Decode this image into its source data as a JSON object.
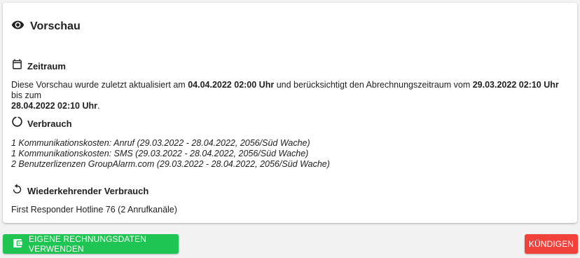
{
  "preview": {
    "title": "Vorschau",
    "icon": "eye-icon"
  },
  "period": {
    "title": "Zeitraum",
    "icon": "calendar-icon",
    "text_prefix": "Diese Vorschau wurde zuletzt aktualisiert am ",
    "updated_at": "04.04.2022 02:00 Uhr",
    "text_middle": " und berücksichtigt den Abrechnungszeitraum vom ",
    "period_start": "29.03.2022 02:10 Uhr",
    "text_until": " bis zum",
    "period_end": "28.04.2022 02:10 Uhr",
    "text_end": "."
  },
  "usage": {
    "title": "Verbrauch",
    "icon": "progress-circle-icon",
    "items": [
      "1 Kommunikationskosten: Anruf (29.03.2022 - 28.04.2022, 2056/Süd Wache)",
      "1 Kommunikationskosten: SMS (29.03.2022 - 28.04.2022, 2056/Süd Wache)",
      "2 Benutzerlizenzen GroupAlarm.com (29.03.2022 - 28.04.2022, 2056/Süd Wache)"
    ]
  },
  "recurring": {
    "title": "Wiederkehrender Verbrauch",
    "icon": "restore-icon",
    "items": [
      "First Responder Hotline 76 (2 Anrufkanäle)"
    ]
  },
  "actions": {
    "own_billing_label": "EIGENE RECHNUNGSDATEN VERWENDEN",
    "own_billing_icon": "wallet-icon",
    "own_billing_color": "#1ec552",
    "cancel_label": "KÜNDIGEN",
    "cancel_color": "#f0413a"
  }
}
